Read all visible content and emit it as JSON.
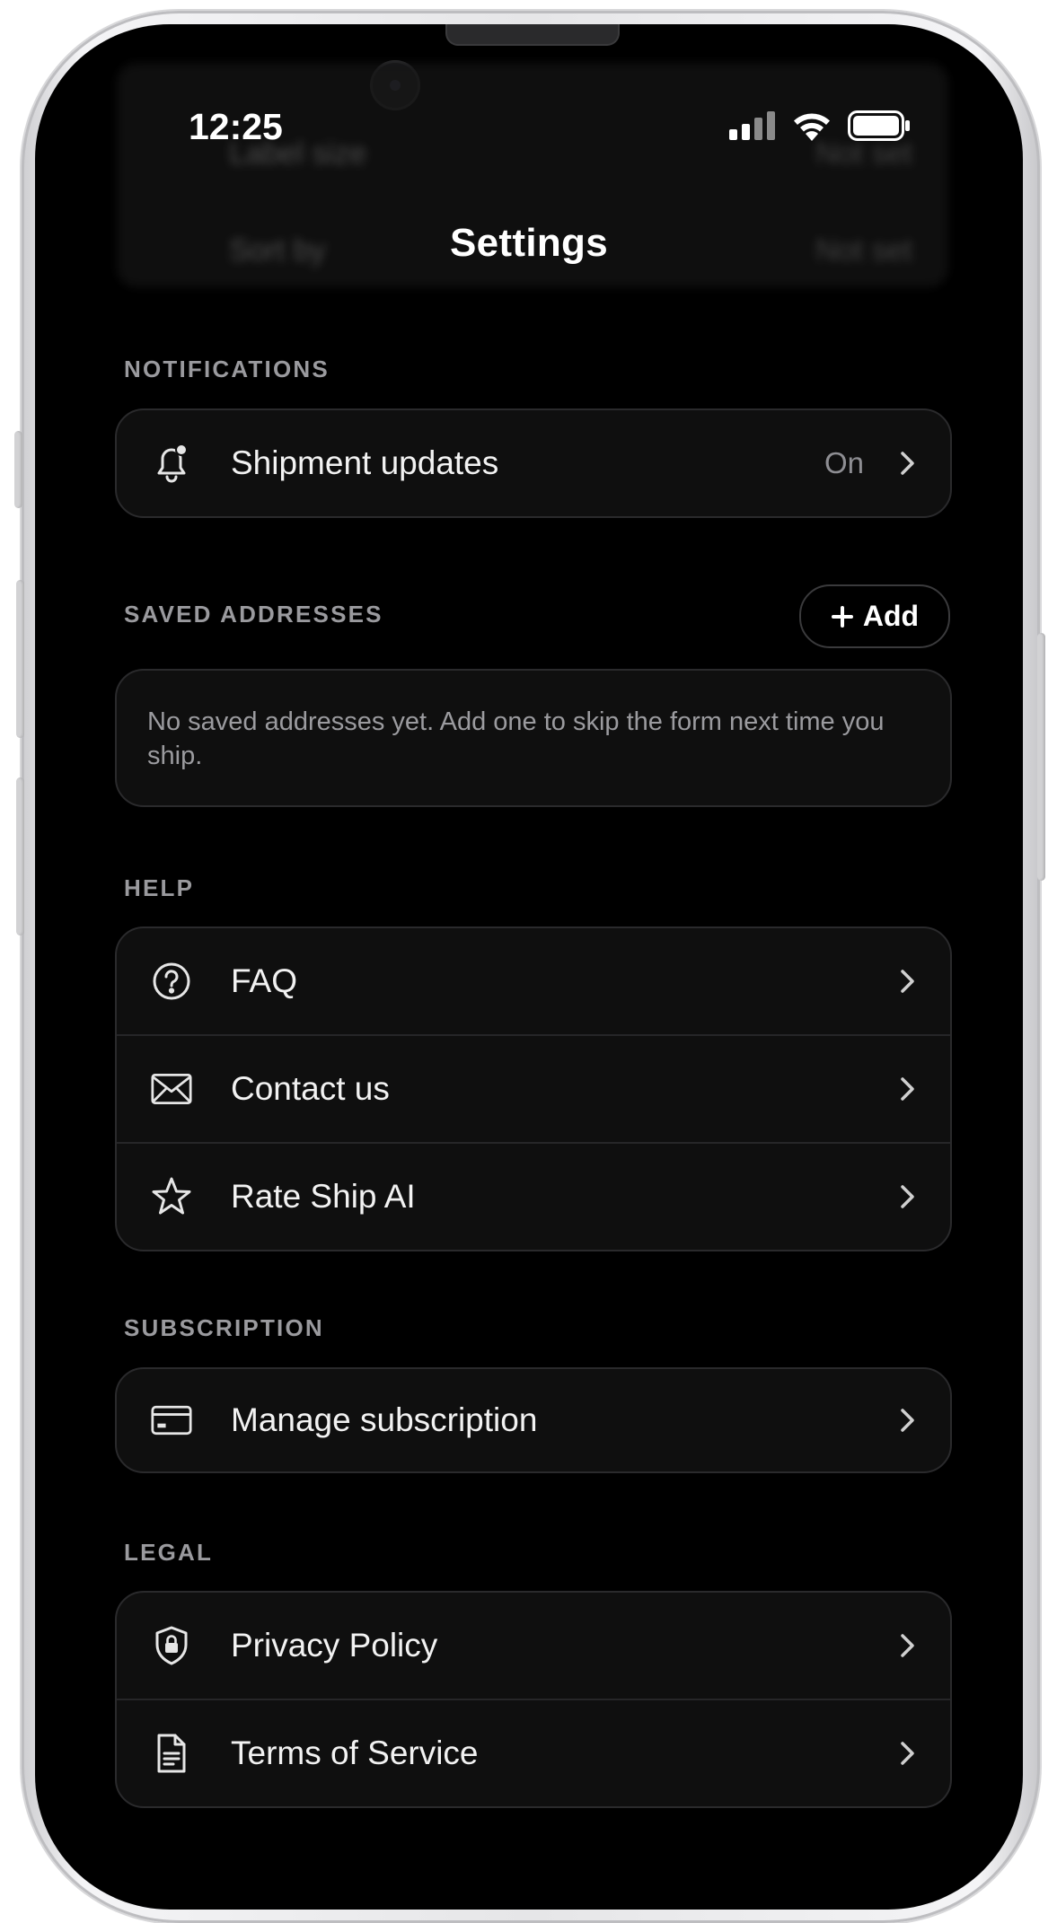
{
  "status_bar": {
    "time": "12:25"
  },
  "header": {
    "title": "Settings",
    "behind_rows": [
      {
        "label": "Label size",
        "value": "Not set"
      },
      {
        "label": "Sort by",
        "value": "Not set"
      }
    ]
  },
  "sections": {
    "notifications": {
      "label": "NOTIFICATIONS",
      "rows": [
        {
          "icon": "bell-icon",
          "label": "Shipment updates",
          "value": "On"
        }
      ]
    },
    "saved_addresses": {
      "label": "SAVED ADDRESSES",
      "add_label": "Add",
      "empty_text": "No saved addresses yet. Add one to skip the form next time you ship."
    },
    "help": {
      "label": "HELP",
      "rows": [
        {
          "icon": "question-circle-icon",
          "label": "FAQ"
        },
        {
          "icon": "envelope-icon",
          "label": "Contact us"
        },
        {
          "icon": "star-icon",
          "label": "Rate Ship AI"
        }
      ]
    },
    "subscription": {
      "label": "SUBSCRIPTION",
      "rows": [
        {
          "icon": "credit-card-icon",
          "label": "Manage subscription"
        }
      ]
    },
    "legal": {
      "label": "LEGAL",
      "rows": [
        {
          "icon": "shield-lock-icon",
          "label": "Privacy Policy"
        },
        {
          "icon": "document-icon",
          "label": "Terms of Service"
        }
      ]
    }
  },
  "colors": {
    "background": "#000000",
    "card": "#0f0f0f",
    "card_border": "#2a2a2c",
    "text_primary": "#f2f2f2",
    "text_secondary": "#8e8e93"
  }
}
